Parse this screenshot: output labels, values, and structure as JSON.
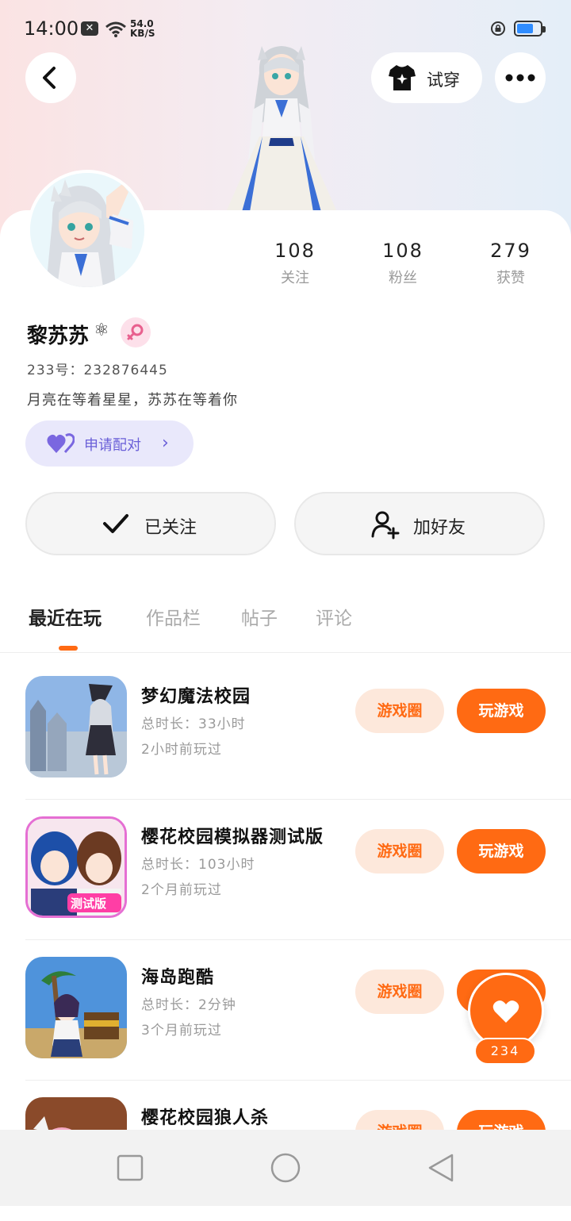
{
  "status_bar": {
    "time": "14:00",
    "net_speed_value": "54.0",
    "net_speed_unit": "KB/S",
    "battery_level": 0.7
  },
  "header": {
    "tryon_label": "试穿"
  },
  "profile": {
    "stats": [
      {
        "num": "108",
        "label": "关注"
      },
      {
        "num": "108",
        "label": "粉丝"
      },
      {
        "num": "279",
        "label": "获赞"
      }
    ],
    "name": "黎苏苏",
    "name_badge": "⚛",
    "uid": "233号：232876445",
    "bio": "月亮在等着星星，苏苏在等着你",
    "pair_label": "申请配对",
    "pair_chevron": "›",
    "follow_label": "已关注",
    "friend_label": "加好友"
  },
  "tabs": [
    "最近在玩",
    "作品栏",
    "帖子",
    "评论"
  ],
  "games": [
    {
      "title": "梦幻魔法校园",
      "duration": "总时长：33小时",
      "last_played": "2小时前玩过",
      "circle_label": "游戏圈",
      "play_label": "玩游戏"
    },
    {
      "title": "樱花校园模拟器测试版",
      "duration": "总时长：103小时",
      "last_played": "2个月前玩过",
      "circle_label": "游戏圈",
      "play_label": "玩游戏"
    },
    {
      "title": "海岛跑酷",
      "duration": "总时长：2分钟",
      "last_played": "3个月前玩过",
      "circle_label": "游戏圈",
      "play_label": "玩游戏"
    },
    {
      "title": "樱花校园狼人杀",
      "duration": "",
      "last_played": "",
      "circle_label": "游戏圈",
      "play_label": "玩游戏"
    }
  ],
  "game_icon_texts": {
    "test_badge": "测试版"
  },
  "like_count": "234",
  "colors": {
    "accent": "#ff6a13",
    "pair_purple": "#6a5fd8",
    "pair_bg": "#e9e8fb"
  }
}
